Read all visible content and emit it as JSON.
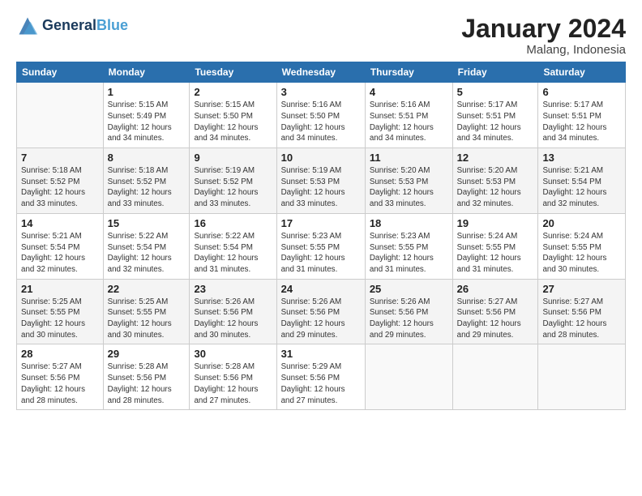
{
  "logo": {
    "line1": "General",
    "line2": "Blue"
  },
  "title": "January 2024",
  "location": "Malang, Indonesia",
  "days_header": [
    "Sunday",
    "Monday",
    "Tuesday",
    "Wednesday",
    "Thursday",
    "Friday",
    "Saturday"
  ],
  "weeks": [
    [
      {
        "num": "",
        "info": ""
      },
      {
        "num": "1",
        "info": "Sunrise: 5:15 AM\nSunset: 5:49 PM\nDaylight: 12 hours\nand 34 minutes."
      },
      {
        "num": "2",
        "info": "Sunrise: 5:15 AM\nSunset: 5:50 PM\nDaylight: 12 hours\nand 34 minutes."
      },
      {
        "num": "3",
        "info": "Sunrise: 5:16 AM\nSunset: 5:50 PM\nDaylight: 12 hours\nand 34 minutes."
      },
      {
        "num": "4",
        "info": "Sunrise: 5:16 AM\nSunset: 5:51 PM\nDaylight: 12 hours\nand 34 minutes."
      },
      {
        "num": "5",
        "info": "Sunrise: 5:17 AM\nSunset: 5:51 PM\nDaylight: 12 hours\nand 34 minutes."
      },
      {
        "num": "6",
        "info": "Sunrise: 5:17 AM\nSunset: 5:51 PM\nDaylight: 12 hours\nand 34 minutes."
      }
    ],
    [
      {
        "num": "7",
        "info": "Sunrise: 5:18 AM\nSunset: 5:52 PM\nDaylight: 12 hours\nand 33 minutes."
      },
      {
        "num": "8",
        "info": "Sunrise: 5:18 AM\nSunset: 5:52 PM\nDaylight: 12 hours\nand 33 minutes."
      },
      {
        "num": "9",
        "info": "Sunrise: 5:19 AM\nSunset: 5:52 PM\nDaylight: 12 hours\nand 33 minutes."
      },
      {
        "num": "10",
        "info": "Sunrise: 5:19 AM\nSunset: 5:53 PM\nDaylight: 12 hours\nand 33 minutes."
      },
      {
        "num": "11",
        "info": "Sunrise: 5:20 AM\nSunset: 5:53 PM\nDaylight: 12 hours\nand 33 minutes."
      },
      {
        "num": "12",
        "info": "Sunrise: 5:20 AM\nSunset: 5:53 PM\nDaylight: 12 hours\nand 32 minutes."
      },
      {
        "num": "13",
        "info": "Sunrise: 5:21 AM\nSunset: 5:54 PM\nDaylight: 12 hours\nand 32 minutes."
      }
    ],
    [
      {
        "num": "14",
        "info": "Sunrise: 5:21 AM\nSunset: 5:54 PM\nDaylight: 12 hours\nand 32 minutes."
      },
      {
        "num": "15",
        "info": "Sunrise: 5:22 AM\nSunset: 5:54 PM\nDaylight: 12 hours\nand 32 minutes."
      },
      {
        "num": "16",
        "info": "Sunrise: 5:22 AM\nSunset: 5:54 PM\nDaylight: 12 hours\nand 31 minutes."
      },
      {
        "num": "17",
        "info": "Sunrise: 5:23 AM\nSunset: 5:55 PM\nDaylight: 12 hours\nand 31 minutes."
      },
      {
        "num": "18",
        "info": "Sunrise: 5:23 AM\nSunset: 5:55 PM\nDaylight: 12 hours\nand 31 minutes."
      },
      {
        "num": "19",
        "info": "Sunrise: 5:24 AM\nSunset: 5:55 PM\nDaylight: 12 hours\nand 31 minutes."
      },
      {
        "num": "20",
        "info": "Sunrise: 5:24 AM\nSunset: 5:55 PM\nDaylight: 12 hours\nand 30 minutes."
      }
    ],
    [
      {
        "num": "21",
        "info": "Sunrise: 5:25 AM\nSunset: 5:55 PM\nDaylight: 12 hours\nand 30 minutes."
      },
      {
        "num": "22",
        "info": "Sunrise: 5:25 AM\nSunset: 5:55 PM\nDaylight: 12 hours\nand 30 minutes."
      },
      {
        "num": "23",
        "info": "Sunrise: 5:26 AM\nSunset: 5:56 PM\nDaylight: 12 hours\nand 30 minutes."
      },
      {
        "num": "24",
        "info": "Sunrise: 5:26 AM\nSunset: 5:56 PM\nDaylight: 12 hours\nand 29 minutes."
      },
      {
        "num": "25",
        "info": "Sunrise: 5:26 AM\nSunset: 5:56 PM\nDaylight: 12 hours\nand 29 minutes."
      },
      {
        "num": "26",
        "info": "Sunrise: 5:27 AM\nSunset: 5:56 PM\nDaylight: 12 hours\nand 29 minutes."
      },
      {
        "num": "27",
        "info": "Sunrise: 5:27 AM\nSunset: 5:56 PM\nDaylight: 12 hours\nand 28 minutes."
      }
    ],
    [
      {
        "num": "28",
        "info": "Sunrise: 5:27 AM\nSunset: 5:56 PM\nDaylight: 12 hours\nand 28 minutes."
      },
      {
        "num": "29",
        "info": "Sunrise: 5:28 AM\nSunset: 5:56 PM\nDaylight: 12 hours\nand 28 minutes."
      },
      {
        "num": "30",
        "info": "Sunrise: 5:28 AM\nSunset: 5:56 PM\nDaylight: 12 hours\nand 27 minutes."
      },
      {
        "num": "31",
        "info": "Sunrise: 5:29 AM\nSunset: 5:56 PM\nDaylight: 12 hours\nand 27 minutes."
      },
      {
        "num": "",
        "info": ""
      },
      {
        "num": "",
        "info": ""
      },
      {
        "num": "",
        "info": ""
      }
    ]
  ]
}
